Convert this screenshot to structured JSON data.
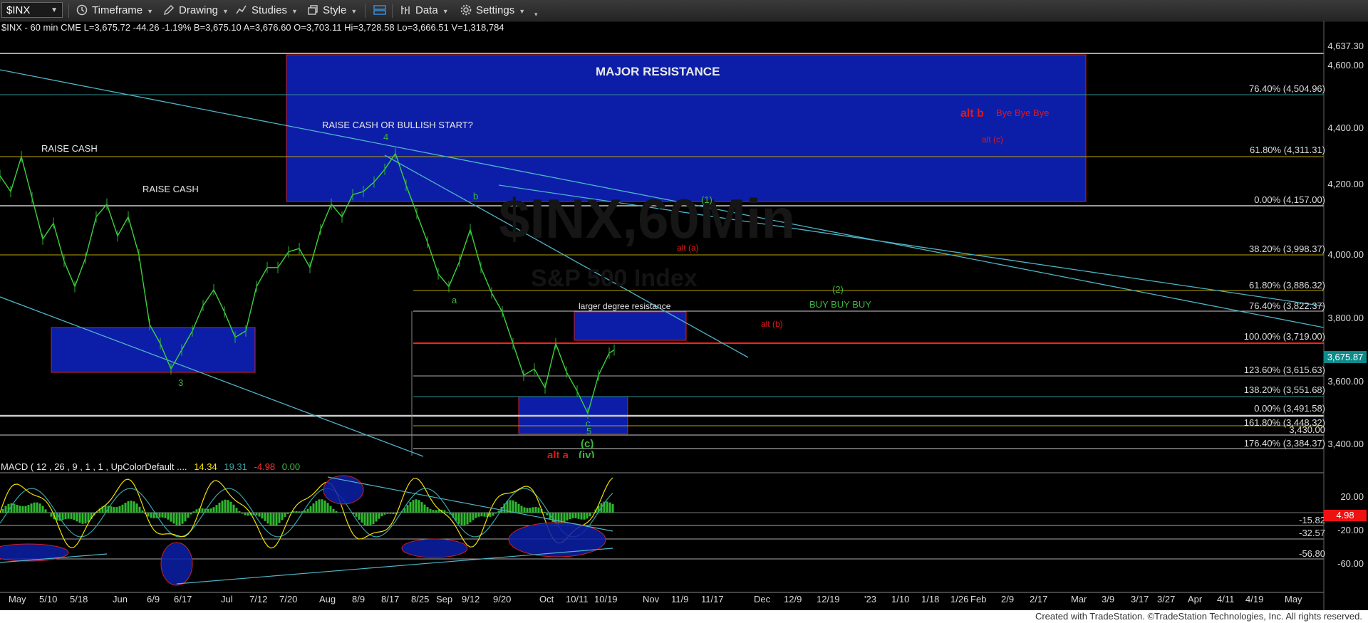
{
  "toolbar": {
    "symbol": "$INX",
    "items": [
      "Timeframe",
      "Drawing",
      "Studies",
      "Style",
      "Data",
      "Settings"
    ]
  },
  "header": {
    "price_line": "$INX - 60 min  CME  L=3,675.72  -44.26  -1.19%  B=3,675.10  A=3,676.60  O=3,703.11  Hi=3,728.58  Lo=3,666.51  V=1,318,784",
    "macd_label": "MACD ( 12 , 26 , 9 , 1 , 1 , UpColorDefault ....",
    "macd_v1": "14.34",
    "macd_v2": "19.31",
    "macd_v3": "-4.98",
    "macd_v4": "0.00"
  },
  "watermark": {
    "big": "$INX,60Min",
    "small": "S&P 500 Index"
  },
  "annotations": {
    "major_resistance": "MAJOR RESISTANCE",
    "raise_cash_1": "RAISE CASH",
    "raise_cash_2": "RAISE CASH",
    "raise_or_bull": "RAISE CASH OR BULLISH START?",
    "wave4": "4",
    "wave3": "3",
    "wave_b": "b",
    "wave_a": "a",
    "wave_c": "c",
    "wave_5": "5",
    "wave_c_paren": "(c)",
    "wave_1_paren": "(1)",
    "wave_2_paren": "(2)",
    "alt_b": "alt b",
    "bye": "Bye Bye Bye",
    "alt_c": "alt (c)",
    "alt_a": "alt (a)",
    "alt_b2": "alt (b)",
    "alt_a_bottom": "alt a",
    "iv": "(iv)",
    "buy": "BUY BUY BUY",
    "larger_res": "larger degree resistance"
  },
  "price_axis": {
    "top": "4,637.30",
    "ticks": [
      "4,600.00",
      "4,400.00",
      "4,200.00",
      "4,000.00",
      "3,800.00",
      "3,600.00",
      "3,400.00"
    ],
    "last_price": "3,675.87",
    "line_3430": "3,430.00"
  },
  "fib_levels": [
    {
      "label": "76.40% (4,504.96)",
      "color": "#3aa3a3"
    },
    {
      "label": "61.80% (4,311.31)",
      "color": "#c8b400"
    },
    {
      "label": "0.00% (4,157.00)",
      "color": "#dddddd"
    },
    {
      "label": "38.20% (3,998.37)",
      "color": "#c8b400"
    },
    {
      "label": "61.80% (3,886.32)",
      "color": "#c8b400"
    },
    {
      "label": "76.40% (3,822.37)",
      "color": "#dddddd"
    },
    {
      "label": "100.00% (3,719.00)",
      "color": "#ff2020"
    },
    {
      "label": "123.60% (3,615.63)",
      "color": "#dddddd"
    },
    {
      "label": "138.20% (3,551.68)",
      "color": "#3aa3a3"
    },
    {
      "label": "0.00% (3,491.58)",
      "color": "#dddddd"
    },
    {
      "label": "161.80% (3,448.32)",
      "color": "#c8b400"
    },
    {
      "label": "176.40% (3,384.37)",
      "color": "#dddddd"
    }
  ],
  "macd_axis": {
    "ticks": [
      "20.00",
      "-20.00",
      "-60.00"
    ],
    "levels": [
      "-15.82",
      "-32.57",
      "-56.80"
    ],
    "current": "4.98"
  },
  "x_axis": [
    "May",
    "5/10",
    "5/18",
    "Jun",
    "6/9",
    "6/17",
    "Jul",
    "7/12",
    "7/20",
    "Aug",
    "8/9",
    "8/17",
    "8/25",
    "Sep",
    "9/12",
    "9/20",
    "Oct",
    "10/11",
    "10/19",
    "Nov",
    "11/9",
    "11/17",
    "Dec",
    "12/9",
    "12/19",
    "'23",
    "1/10",
    "1/18",
    "1/26",
    "Feb",
    "2/9",
    "2/17",
    "Mar",
    "3/9",
    "3/17",
    "3/27",
    "Apr",
    "4/11",
    "4/19",
    "May"
  ],
  "footer": "Created with TradeStation. ©TradeStation Technologies, Inc. All rights reserved.",
  "chart_data": {
    "type": "line",
    "ylim": [
      3340,
      4680
    ],
    "series": [
      {
        "values": [
          [
            0,
            4250
          ],
          [
            15,
            4200
          ],
          [
            30,
            4310
          ],
          [
            45,
            4180
          ],
          [
            60,
            4050
          ],
          [
            75,
            4100
          ],
          [
            90,
            3980
          ],
          [
            105,
            3900
          ],
          [
            120,
            3990
          ],
          [
            135,
            4120
          ],
          [
            150,
            4160
          ],
          [
            165,
            4060
          ],
          [
            180,
            4120
          ],
          [
            195,
            4000
          ],
          [
            210,
            3780
          ],
          [
            225,
            3720
          ],
          [
            240,
            3640
          ],
          [
            255,
            3700
          ],
          [
            270,
            3760
          ],
          [
            285,
            3840
          ],
          [
            300,
            3890
          ],
          [
            315,
            3820
          ],
          [
            330,
            3740
          ],
          [
            345,
            3760
          ],
          [
            360,
            3900
          ],
          [
            375,
            3960
          ],
          [
            390,
            3960
          ],
          [
            405,
            4010
          ],
          [
            420,
            4020
          ],
          [
            435,
            3960
          ],
          [
            450,
            4080
          ],
          [
            465,
            4160
          ],
          [
            480,
            4120
          ],
          [
            495,
            4190
          ],
          [
            510,
            4200
          ],
          [
            525,
            4230
          ],
          [
            540,
            4270
          ],
          [
            555,
            4320
          ],
          [
            570,
            4220
          ],
          [
            585,
            4130
          ],
          [
            600,
            4040
          ],
          [
            615,
            3940
          ],
          [
            630,
            3900
          ],
          [
            645,
            3980
          ],
          [
            660,
            4080
          ],
          [
            675,
            3960
          ],
          [
            690,
            3880
          ],
          [
            705,
            3820
          ],
          [
            720,
            3720
          ],
          [
            735,
            3620
          ],
          [
            750,
            3640
          ],
          [
            765,
            3580
          ],
          [
            780,
            3720
          ],
          [
            795,
            3630
          ],
          [
            810,
            3570
          ],
          [
            825,
            3500
          ],
          [
            840,
            3620
          ],
          [
            855,
            3690
          ],
          [
            862,
            3700
          ]
        ]
      }
    ]
  }
}
